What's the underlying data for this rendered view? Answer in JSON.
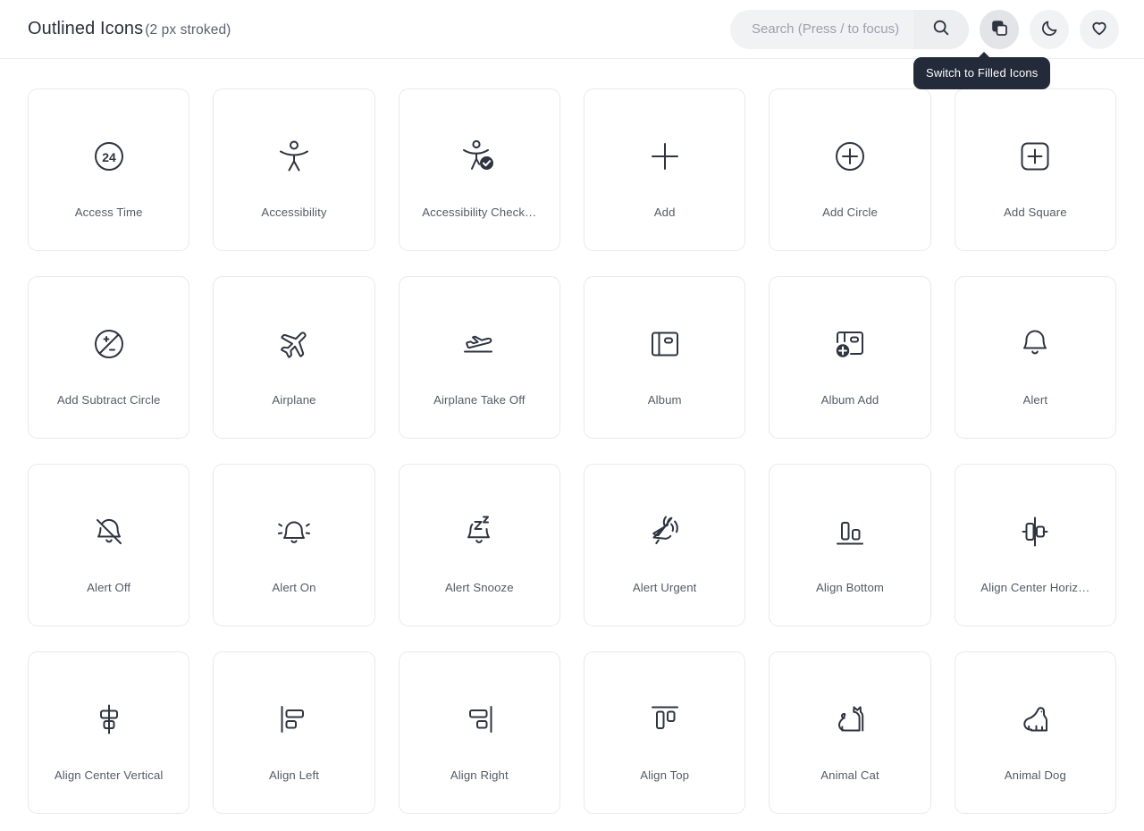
{
  "header": {
    "title": "Outlined Icons",
    "subtitle": "(2 px stroked)",
    "search": {
      "value": "",
      "placeholder": "Search (Press / to focus)"
    },
    "buttons": {
      "search_label": "search-icon",
      "switch_style_label": "copy-icon",
      "dark_mode_label": "moon-icon",
      "favorites_label": "heart-icon"
    },
    "tooltip": "Switch to Filled Icons"
  },
  "colors": {
    "icon": "#2e3440",
    "caption": "#555b67",
    "card_border": "#e9eaee",
    "page_bg": "#ffffff",
    "chip_bg": "#f1f2f4",
    "chip_bg_active": "#e2e4e8",
    "tooltip_bg": "#232b3a",
    "title": "#2b313c"
  },
  "icons": [
    {
      "name": "Access Time",
      "icon": "access-time-icon"
    },
    {
      "name": "Accessibility",
      "icon": "accessibility-icon"
    },
    {
      "name": "Accessibility Check…",
      "icon": "accessibility-check-icon"
    },
    {
      "name": "Add",
      "icon": "add-icon"
    },
    {
      "name": "Add Circle",
      "icon": "add-circle-icon"
    },
    {
      "name": "Add Square",
      "icon": "add-square-icon"
    },
    {
      "name": "Add Subtract Circle",
      "icon": "add-subtract-circle-icon"
    },
    {
      "name": "Airplane",
      "icon": "airplane-icon"
    },
    {
      "name": "Airplane Take Off",
      "icon": "airplane-take-off-icon"
    },
    {
      "name": "Album",
      "icon": "album-icon"
    },
    {
      "name": "Album Add",
      "icon": "album-add-icon"
    },
    {
      "name": "Alert",
      "icon": "alert-icon"
    },
    {
      "name": "Alert Off",
      "icon": "alert-off-icon"
    },
    {
      "name": "Alert On",
      "icon": "alert-on-icon"
    },
    {
      "name": "Alert Snooze",
      "icon": "alert-snooze-icon"
    },
    {
      "name": "Alert Urgent",
      "icon": "alert-urgent-icon"
    },
    {
      "name": "Align Bottom",
      "icon": "align-bottom-icon"
    },
    {
      "name": "Align Center Horiz…",
      "icon": "align-center-horizontal-icon"
    },
    {
      "name": "Align Center Vertical",
      "icon": "align-center-vertical-icon"
    },
    {
      "name": "Align Left",
      "icon": "align-left-icon"
    },
    {
      "name": "Align Right",
      "icon": "align-right-icon"
    },
    {
      "name": "Align Top",
      "icon": "align-top-icon"
    },
    {
      "name": "Animal Cat",
      "icon": "animal-cat-icon"
    },
    {
      "name": "Animal Dog",
      "icon": "animal-dog-icon"
    }
  ]
}
